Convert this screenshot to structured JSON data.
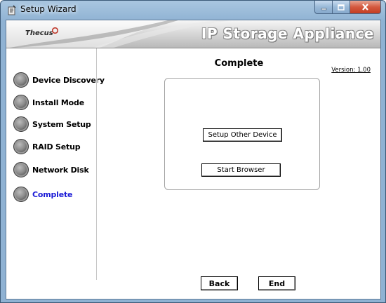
{
  "window": {
    "title": "Setup Wizard",
    "icon": "wizard-app-icon"
  },
  "banner": {
    "logo": "Thecus",
    "title": "IP Storage Appliance"
  },
  "sidebar": {
    "steps": [
      {
        "label": "Device Discovery",
        "active": false
      },
      {
        "label": "Install Mode",
        "active": false
      },
      {
        "label": "System Setup",
        "active": false
      },
      {
        "label": "RAID Setup",
        "active": false
      },
      {
        "label": "Network Disk",
        "active": false
      },
      {
        "label": "Complete",
        "active": true
      }
    ]
  },
  "main": {
    "title": "Complete",
    "version": "Version: 1.00",
    "setup_other_label": "Setup Other Device",
    "start_browser_label": "Start Browser"
  },
  "footer": {
    "back_label": "Back",
    "end_label": "End"
  },
  "colors": {
    "active_step": "#1b1bd6",
    "window_frame": "#8fb2d3",
    "close_button": "#c33d22"
  }
}
